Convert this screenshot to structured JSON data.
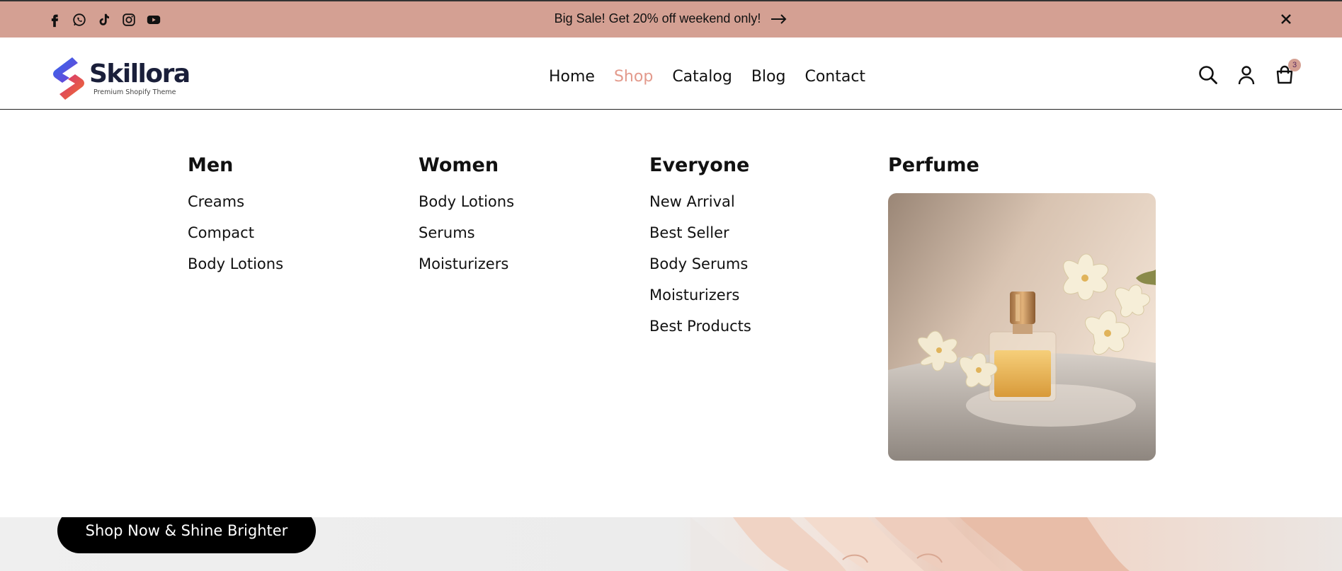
{
  "announcement": {
    "message": "Big Sale! Get 20% off weekend only!",
    "arrow_icon": "arrow-right-icon",
    "close_icon": "close-icon",
    "social_icons": [
      "facebook-icon",
      "whatsapp-icon",
      "tiktok-icon",
      "instagram-icon",
      "youtube-icon"
    ],
    "background": "#d4a093"
  },
  "header": {
    "logo": {
      "name": "Skillora",
      "tagline": "Premium Shopify Theme"
    },
    "nav": [
      {
        "label": "Home",
        "active": false
      },
      {
        "label": "Shop",
        "active": true
      },
      {
        "label": "Catalog",
        "active": false
      },
      {
        "label": "Blog",
        "active": false
      },
      {
        "label": "Contact",
        "active": false
      }
    ],
    "icons": [
      "search-icon",
      "account-icon",
      "cart-icon"
    ],
    "cart_count": "3",
    "accent_color": "#e39a8c"
  },
  "mega_menu": {
    "men": {
      "title": "Men",
      "items": [
        "Creams",
        "Compact",
        "Body Lotions"
      ]
    },
    "women": {
      "title": "Women",
      "items": [
        "Body Lotions",
        "Serums",
        "Moisturizers"
      ]
    },
    "everyone": {
      "title": "Everyone",
      "items": [
        "New Arrival",
        "Best Seller",
        "Body Serums",
        "Moisturizers",
        "Best Products"
      ]
    },
    "perfume": {
      "title": "Perfume"
    }
  },
  "hero": {
    "cta_label": "Shop Now & Shine Brighter"
  }
}
